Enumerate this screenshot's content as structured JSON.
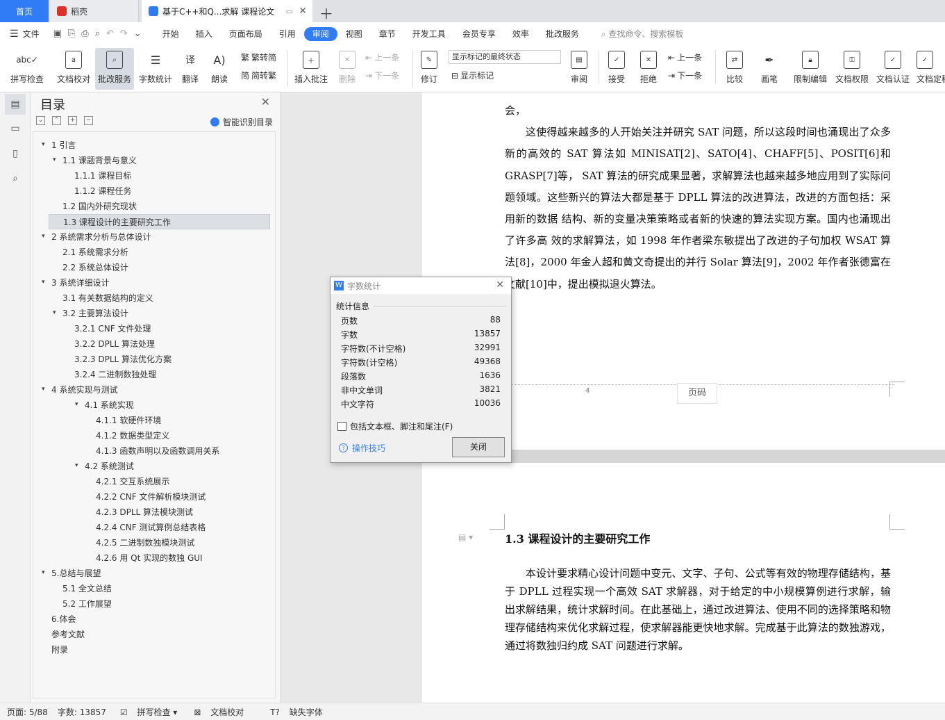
{
  "tabs": {
    "home": "首页",
    "daoke": "稻壳",
    "doc": "基于C++和Q...求解 课程论文"
  },
  "menu": {
    "file": "文件",
    "items": [
      "开始",
      "插入",
      "页面布局",
      "引用",
      "审阅",
      "视图",
      "章节",
      "开发工具",
      "会员专享",
      "效率",
      "批改服务"
    ],
    "active": "审阅",
    "search": "查找命令、搜索模板"
  },
  "ribbon": {
    "spell": "拼写检查",
    "proof": "文档校对",
    "correct": "批改服务",
    "wordcount": "字数统计",
    "translate": "翻译",
    "read": "朗读",
    "trad": "繁转简",
    "simp": "简转繁",
    "insert_comment": "插入批注",
    "delete": "删除",
    "prev": "上一条",
    "next": "下一条",
    "revise": "修订",
    "markup_state": "显示标记的最终状态",
    "show_markup": "显示标记",
    "review": "审阅",
    "accept": "接受",
    "reject": "拒绝",
    "prev2": "上一条",
    "next2": "下一条",
    "compare": "比较",
    "ink": "画笔",
    "restrict": "限制编辑",
    "perm": "文档权限",
    "auth": "文档认证",
    "final": "文档定稿"
  },
  "toc": {
    "title": "目录",
    "smart": "智能识别目录",
    "items": [
      {
        "text": "1  引言"
      },
      {
        "text": "1.1  课题背景与意义"
      },
      {
        "text": "1.1.1  课程目标"
      },
      {
        "text": "1.1.2  课程任务"
      },
      {
        "text": "1.2  国内外研究现状"
      },
      {
        "text": "1.3  课程设计的主要研究工作"
      },
      {
        "text": "2  系统需求分析与总体设计"
      },
      {
        "text": "2.1  系统需求分析"
      },
      {
        "text": "2.2  系统总体设计"
      },
      {
        "text": "3  系统详细设计"
      },
      {
        "text": "3.1  有关数据结构的定义"
      },
      {
        "text": "3.2 主要算法设计"
      },
      {
        "text": "3.2.1 CNF 文件处理"
      },
      {
        "text": "3.2.2 DPLL 算法处理"
      },
      {
        "text": "3.2.3 DPLL 算法优化方案"
      },
      {
        "text": "3.2.4  二进制数独处理"
      },
      {
        "text": "4  系统实现与测试"
      },
      {
        "text": "4.1  系统实现"
      },
      {
        "text": "4.1.1  软硬件环境"
      },
      {
        "text": "4.1.2  数据类型定义"
      },
      {
        "text": "4.1.3  函数声明以及函数调用关系"
      },
      {
        "text": "4.2  系统测试"
      },
      {
        "text": "4.2.1  交互系统展示"
      },
      {
        "text": "4.2.2 CNF 文件解析模块测试"
      },
      {
        "text": "4.2.3 DPLL 算法模块测试"
      },
      {
        "text": "4.2.4 CNF 测试算例总结表格"
      },
      {
        "text": "4.2.5  二进制数独模块测试"
      },
      {
        "text": "4.2.6  用 Qt 实现的数独 GUI"
      },
      {
        "text": "5.总结与展望"
      },
      {
        "text": "5.1  全文总结"
      },
      {
        "text": "5.2 工作展望"
      },
      {
        "text": "6.体会"
      },
      {
        "text": "参考文献"
      },
      {
        "text": "附录"
      }
    ]
  },
  "doc": {
    "top_partial": "会，",
    "para1": "这使得越来越多的人开始关注并研究 SAT 问题，所以这段时间也涌现出了众多新的高效的 SAT 算法如 MINISAT[2]、SATO[4]、CHAFF[5]、POSIT[6]和 GRASP[7]等， SAT 算法的研究成果显著，求解算法也越来越多地应用到了实际问题领域。这些新兴的算法大都是基于 DPLL 算法的改进算法，改进的方面包括：采用新的数据 结构、新的变量决策策略或者新的快速的算法实现方案。国内也涌现出了许多高 效的求解算法，如 1998 年作者梁东敏提出了改进的子句加权 WSAT 算法[8]，2000 年金人超和黄文奇提出的并行 Solar 算法[9]，2002 年作者张德富在文献[10]中，提出模拟退火算法。",
    "footer_num": "4",
    "page_code": "页码",
    "heading": "1.3  课程设计的主要研究工作",
    "para2": "本设计要求精心设计问题中变元、文字、子句、公式等有效的物理存储结构，基于 DPLL 过程实现一个高效 SAT 求解器，对于给定的中小规模算例进行求解，输出求解结果，统计求解时间。在此基础上，通过改进算法、使用不同的选择策略和物理存储结构来优化求解过程，使求解器能更快地求解。完成基于此算法的数独游戏，通过将数独归约成 SAT 问题进行求解。"
  },
  "dialog": {
    "title": "字数统计",
    "group": "统计信息",
    "rows": [
      {
        "label": "页数",
        "value": "88"
      },
      {
        "label": "字数",
        "value": "13857"
      },
      {
        "label": "字符数(不计空格)",
        "value": "32991"
      },
      {
        "label": "字符数(计空格)",
        "value": "49368"
      },
      {
        "label": "段落数",
        "value": "1636"
      },
      {
        "label": "非中文单词",
        "value": "3821"
      },
      {
        "label": "中文字符",
        "value": "10036"
      }
    ],
    "include": "包括文本框、脚注和尾注(F)",
    "tips": "操作技巧",
    "close": "关闭"
  },
  "status": {
    "page": "页面: 5/88",
    "words": "字数: 13857",
    "spell": "拼写检查",
    "proof": "文档校对",
    "font": "缺失字体"
  },
  "colors": {
    "accent": "#2f7cf6"
  }
}
